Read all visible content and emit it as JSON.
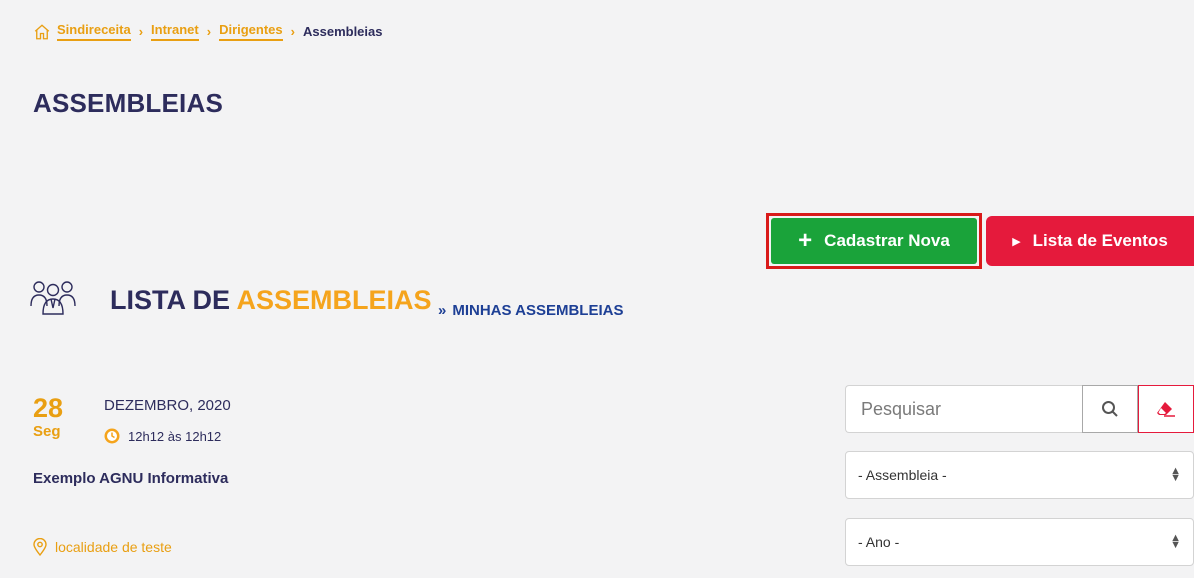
{
  "breadcrumb": {
    "items": [
      {
        "label": "Sindireceita"
      },
      {
        "label": "Intranet"
      },
      {
        "label": "Dirigentes"
      }
    ],
    "current": "Assembleias",
    "separator": "›"
  },
  "page": {
    "title": "ASSEMBLEIAS"
  },
  "actions": {
    "new_label": "Cadastrar Nova",
    "events_label": "Lista de Eventos"
  },
  "list": {
    "heading_part1": "LISTA DE",
    "heading_part2": "ASSEMBLEIAS",
    "my_link_label": "MINHAS ASSEMBLEIAS",
    "my_link_chevron": "»"
  },
  "event": {
    "day": "28",
    "weekday": "Seg",
    "month_year": "DEZEMBRO, 2020",
    "time": "12h12 às 12h12",
    "title": "Exemplo AGNU Informativa",
    "location": "localidade de teste"
  },
  "filters": {
    "search_placeholder": "Pesquisar",
    "assembly_select": "- Assembleia -",
    "year_select": "- Ano -"
  },
  "colors": {
    "navy": "#2d2c5c",
    "orange": "#e99f12",
    "green": "#1aa33a",
    "red": "#e51a3c",
    "link_blue": "#1d3f95"
  }
}
